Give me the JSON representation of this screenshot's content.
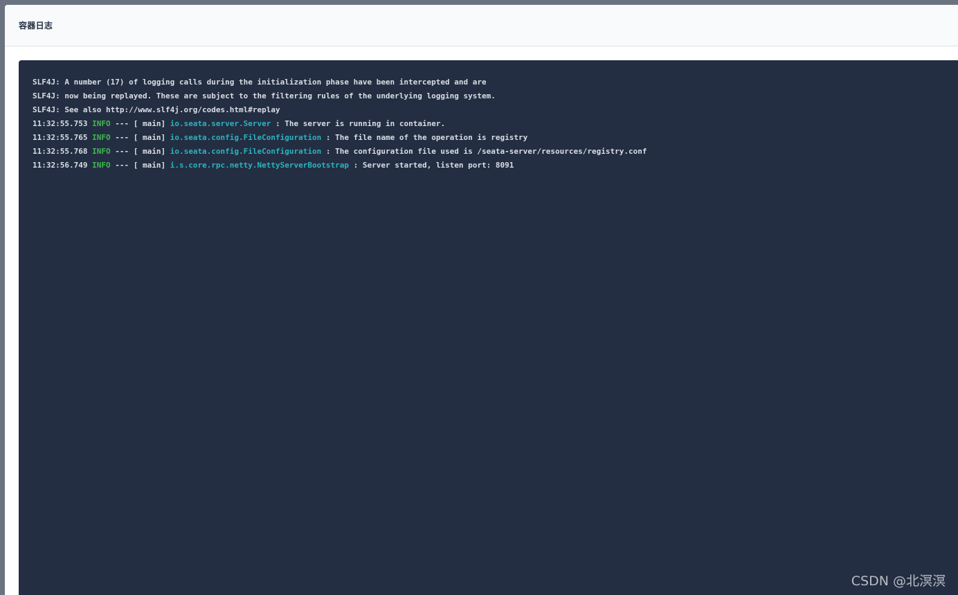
{
  "dialog": {
    "title": "容器日志"
  },
  "log": {
    "plain_lines": [
      "SLF4J: A number (17) of logging calls during the initialization phase have been intercepted and are",
      "SLF4J: now being replayed. These are subject to the filtering rules of the underlying logging system.",
      "SLF4J: See also http://www.slf4j.org/codes.html#replay"
    ],
    "entries": [
      {
        "time": "11:32:55.753",
        "level": "INFO",
        "sep": " --- [ main] ",
        "logger": "io.seata.server.Server",
        "message": " : The server is running in container."
      },
      {
        "time": "11:32:55.765",
        "level": "INFO",
        "sep": " --- [ main] ",
        "logger": "io.seata.config.FileConfiguration",
        "message": " : The file name of the operation is registry"
      },
      {
        "time": "11:32:55.768",
        "level": "INFO",
        "sep": " --- [ main] ",
        "logger": "io.seata.config.FileConfiguration",
        "message": " : The configuration file used is /seata-server/resources/registry.conf"
      },
      {
        "time": "11:32:56.749",
        "level": "INFO",
        "sep": " --- [ main] ",
        "logger": "i.s.core.rpc.netty.NettyServerBootstrap",
        "message": " : Server started, listen port: 8091"
      }
    ]
  },
  "watermark": "CSDN @北溟溟",
  "colors": {
    "panel_bg": "#242e42",
    "level_info": "#3fb950",
    "logger": "#2bb3c0",
    "text": "#d8dee5"
  }
}
